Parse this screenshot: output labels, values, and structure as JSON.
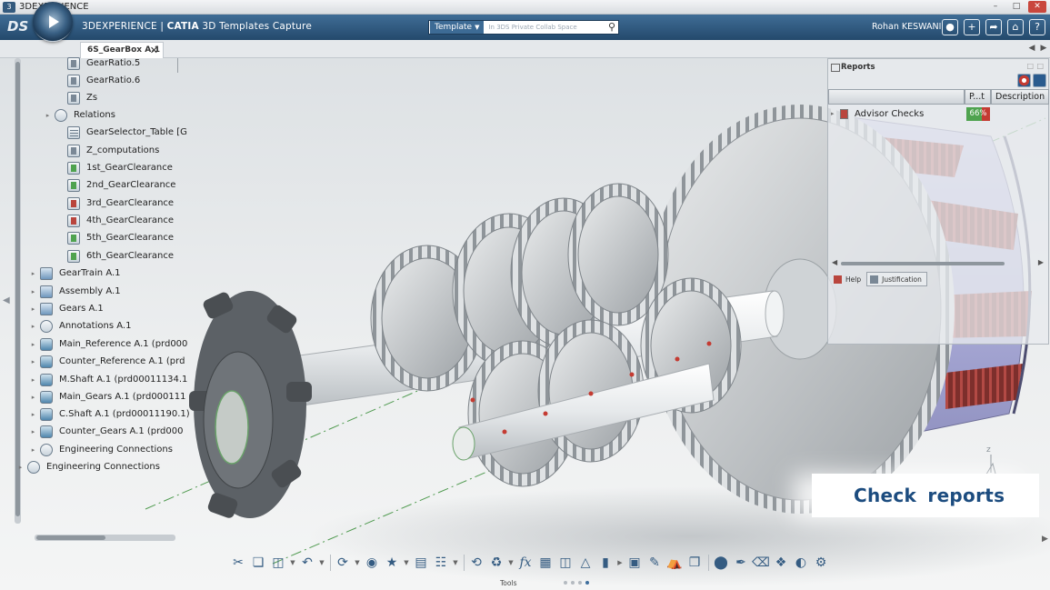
{
  "window": {
    "title": "3DEXPERIENCE"
  },
  "topbar": {
    "brand_light": "3DEXPERIENCE",
    "brand_bold": "CATIA",
    "brand_app": "3D Templates Capture",
    "search_tag": "Template",
    "search_placeholder": "In 3DS Private Collab Space",
    "user": "Rohan KESWANI"
  },
  "tab": {
    "label": "6S_GearBox A.1"
  },
  "tree": {
    "items": [
      {
        "label": "GearRatio.5",
        "icon": "parameter-icon"
      },
      {
        "label": "GearRatio.6",
        "icon": "parameter-icon"
      },
      {
        "label": "Zs",
        "icon": "parameter-icon"
      },
      {
        "label": "Relations",
        "icon": "relations-icon"
      },
      {
        "label": "GearSelector_Table [G",
        "icon": "design-table-icon"
      },
      {
        "label": "Z_computations",
        "icon": "formula-icon"
      },
      {
        "label": "1st_GearClearance",
        "icon": "check-ok-icon"
      },
      {
        "label": "2nd_GearClearance",
        "icon": "check-ok-icon"
      },
      {
        "label": "3rd_GearClearance",
        "icon": "check-failed-icon"
      },
      {
        "label": "4th_GearClearance",
        "icon": "check-failed-icon"
      },
      {
        "label": "5th_GearClearance",
        "icon": "check-ok-icon"
      },
      {
        "label": "6th_GearClearance",
        "icon": "check-ok-icon"
      },
      {
        "label": "GearTrain A.1",
        "icon": "part-icon"
      },
      {
        "label": "Assembly A.1",
        "icon": "part-icon"
      },
      {
        "label": "Gears A.1",
        "icon": "part-icon"
      },
      {
        "label": "Annotations A.1",
        "icon": "annotation-icon"
      },
      {
        "label": "Main_Reference A.1 (prd000",
        "icon": "product-icon"
      },
      {
        "label": "Counter_Reference A.1 (prd",
        "icon": "product-icon"
      },
      {
        "label": "M.Shaft A.1 (prd00011134.1",
        "icon": "product-icon"
      },
      {
        "label": "Main_Gears A.1 (prd000111",
        "icon": "product-icon"
      },
      {
        "label": "C.Shaft A.1 (prd00011190.1)",
        "icon": "product-icon"
      },
      {
        "label": "Counter_Gears A.1 (prd000",
        "icon": "product-icon"
      },
      {
        "label": "Engineering Connections",
        "icon": "engineering-connection-icon"
      },
      {
        "label": "Engineering Connections",
        "icon": "engineering-connection-icon"
      }
    ]
  },
  "reports": {
    "title": "Reports",
    "columns": [
      "",
      "P...t",
      "Description"
    ],
    "row": {
      "label": "Advisor Checks",
      "percent": "66%"
    },
    "tabs": [
      "Help",
      "Justification"
    ]
  },
  "caption": "Check  reports",
  "toolbar": {
    "label": "Tools"
  },
  "colors": {
    "accent": "#24496c",
    "caption": "#1c4c7f",
    "ok": "#4fa34f",
    "fail": "#c43b32"
  }
}
